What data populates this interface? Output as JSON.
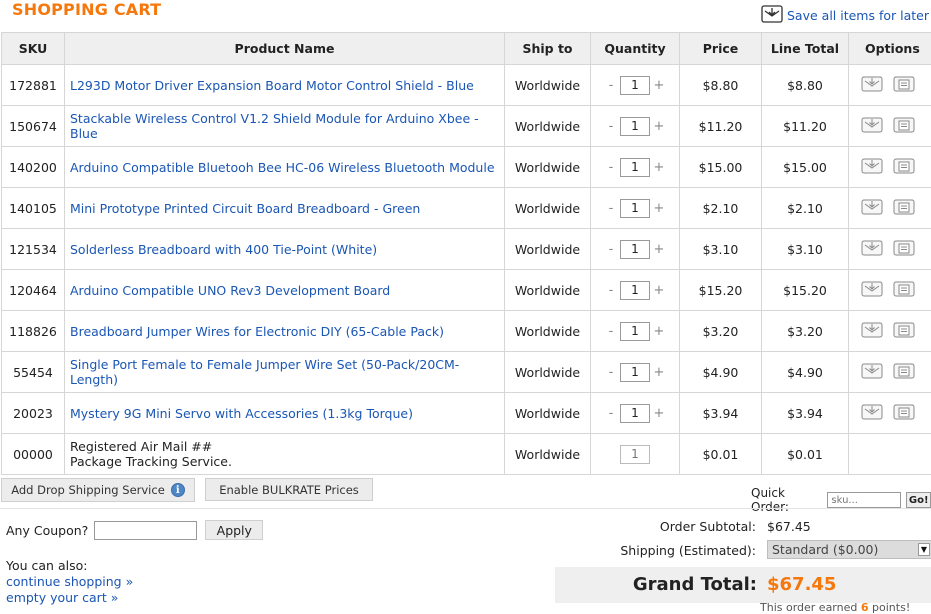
{
  "header": {
    "title": "SHOPPING CART",
    "save_all": "Save all items for later"
  },
  "table": {
    "columns": [
      "SKU",
      "Product Name",
      "Ship to",
      "Quantity",
      "Price",
      "Line Total",
      "Options"
    ],
    "rows": [
      {
        "sku": "172881",
        "name": "L293D Motor Driver Expansion Board Motor Control Shield - Blue",
        "ship": "Worldwide",
        "qty": "1",
        "price": "$8.80",
        "total": "$8.80"
      },
      {
        "sku": "150674",
        "name": "Stackable Wireless Control V1.2 Shield Module for Arduino Xbee - Blue",
        "ship": "Worldwide",
        "qty": "1",
        "price": "$11.20",
        "total": "$11.20"
      },
      {
        "sku": "140200",
        "name": "Arduino Compatible Bluetooh Bee HC-06 Wireless Bluetooth Module",
        "ship": "Worldwide",
        "qty": "1",
        "price": "$15.00",
        "total": "$15.00"
      },
      {
        "sku": "140105",
        "name": "Mini Prototype Printed Circuit Board Breadboard - Green",
        "ship": "Worldwide",
        "qty": "1",
        "price": "$2.10",
        "total": "$2.10"
      },
      {
        "sku": "121534",
        "name": "Solderless Breadboard with 400 Tie-Point (White)",
        "ship": "Worldwide",
        "qty": "1",
        "price": "$3.10",
        "total": "$3.10"
      },
      {
        "sku": "120464",
        "name": "Arduino Compatible UNO Rev3 Development Board",
        "ship": "Worldwide",
        "qty": "1",
        "price": "$15.20",
        "total": "$15.20"
      },
      {
        "sku": "118826",
        "name": "Breadboard Jumper Wires for Electronic DIY (65-Cable Pack)",
        "ship": "Worldwide",
        "qty": "1",
        "price": "$3.20",
        "total": "$3.20"
      },
      {
        "sku": "55454",
        "name": "Single Port Female to Female Jumper Wire Set (50-Pack/20CM-Length)",
        "ship": "Worldwide",
        "qty": "1",
        "price": "$4.90",
        "total": "$4.90"
      },
      {
        "sku": "20023",
        "name": "Mystery 9G Mini Servo with Accessories (1.3kg Torque)",
        "ship": "Worldwide",
        "qty": "1",
        "price": "$3.94",
        "total": "$3.94"
      }
    ],
    "service_row": {
      "sku": "00000",
      "name_line1": "Registered Air Mail ##",
      "name_line2": "Package Tracking Service.",
      "ship": "Worldwide",
      "qty": "1",
      "price": "$0.01",
      "total": "$0.01"
    },
    "qty_minus": "-",
    "qty_plus": "+"
  },
  "actions": {
    "drop_shipping": "Add Drop Shipping Service",
    "info_glyph": "i",
    "bulkrate": "Enable BULKRATE Prices",
    "quick_order_label": "Quick Order:",
    "quick_order_placeholder": "sku...",
    "go": "Go!"
  },
  "coupon": {
    "label": "Any Coupon?",
    "apply": "Apply"
  },
  "also": {
    "label": "You can also:",
    "continue": "continue shopping »",
    "empty": "empty your cart »"
  },
  "summary": {
    "subtotal_label": "Order Subtotal:",
    "subtotal_value": "$67.45",
    "shipping_label": "Shipping (Estimated):",
    "shipping_value": "Standard ($0.00)",
    "grand_label": "Grand Total:",
    "grand_value": "$67.45",
    "earned_prefix": "This order earned",
    "earned_points": "6",
    "earned_suffix": "points!"
  },
  "icons": {
    "save_all": "save-for-later-icon",
    "option_a": "save-item-icon",
    "option_b": "remove-item-icon"
  },
  "colors": {
    "accent_orange": "#f5780c",
    "link_blue": "#1a56b4",
    "header_gray": "#efefef"
  }
}
